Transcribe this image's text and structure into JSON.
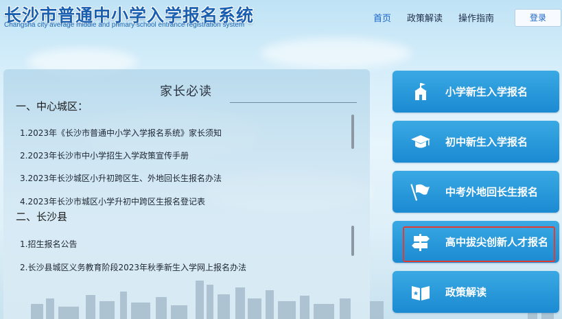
{
  "header": {
    "title_cn": "长沙市普通中小学入学报名系统",
    "title_en": "Changsha city average middle and primary school entrance registration system",
    "nav": [
      "首页",
      "政策解读",
      "操作指南"
    ],
    "login_label": "登录"
  },
  "panel": {
    "title": "家长必读",
    "sections": [
      {
        "heading": "一、中心城区：",
        "items": [
          "1.2023年《长沙市普通中小学入学报名系统》家长须知",
          "2.2023年长沙市中小学招生入学政策宣传手册",
          "3.2023年长沙城区小升初跨区生、外地回长生报名办法",
          "4.2023年长沙市城区小学升初中跨区生报名登记表"
        ]
      },
      {
        "heading": "二、长沙县",
        "items": [
          "1.招生报名公告",
          "2.长沙县城区义务教育阶段2023年秋季新生入学网上报名办法"
        ]
      }
    ]
  },
  "portals": [
    {
      "label": "小学新生入学报名",
      "icon": "school-building-icon"
    },
    {
      "label": "初中新生入学报名",
      "icon": "graduation-cap-icon"
    },
    {
      "label": "中考外地回长生报名",
      "icon": "flag-icon"
    },
    {
      "label": "高中拔尖创新人才报名",
      "icon": "signpost-icon"
    },
    {
      "label": "政策解读",
      "icon": "open-book-icon"
    }
  ],
  "colors": {
    "accent": "#1a64c8",
    "portal_top": "#3aa9e3",
    "portal_bottom": "#1b8ad2",
    "highlight": "#e53a30"
  }
}
